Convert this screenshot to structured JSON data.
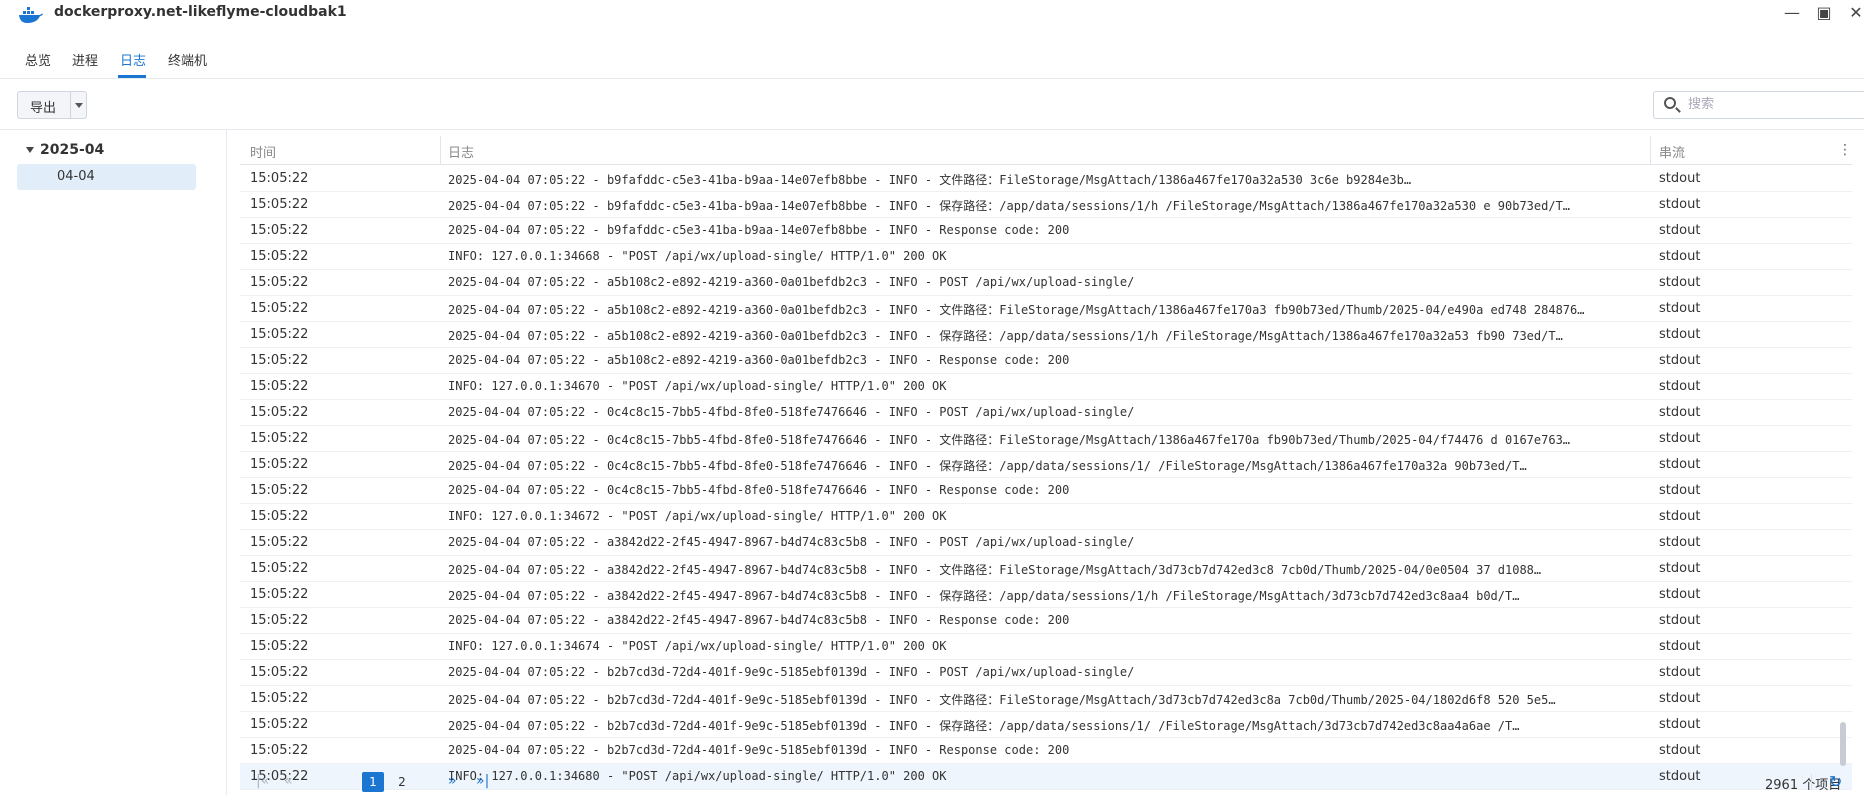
{
  "window": {
    "title": "dockerproxy.net-likeflyme-cloudbak1",
    "minimize_glyph": "—",
    "maximize_glyph": "▣",
    "close_glyph": "✕"
  },
  "tabs": [
    {
      "label": "总览"
    },
    {
      "label": "进程"
    },
    {
      "label": "日志"
    },
    {
      "label": "终端机"
    }
  ],
  "active_tab": "日志",
  "toolbar": {
    "export_label": "导出",
    "search_placeholder": "搜索",
    "search_value": ""
  },
  "sidebar": {
    "year": "2025-04",
    "month": "04-04"
  },
  "columns": {
    "time": "时间",
    "log": "日志",
    "stream": "串流"
  },
  "rows": [
    {
      "time": "15:05:22",
      "message": "2025-04-04 07:05:22 - b9fafddc-c5e3-41ba-b9aa-14e07efb8bbe - INFO - 文件路径：FileStorage/MsgAttach/1386a467fe170a32a530          3c6e  b9284e3b…",
      "stream": "stdout"
    },
    {
      "time": "15:05:22",
      "message": "2025-04-04 07:05:22 - b9fafddc-c5e3-41ba-b9aa-14e07efb8bbe - INFO - 保存路径：/app/data/sessions/1/h          /FileStorage/MsgAttach/1386a467fe170a32a530  e   90b73ed/T…",
      "stream": "stdout"
    },
    {
      "time": "15:05:22",
      "message": "2025-04-04 07:05:22 - b9fafddc-c5e3-41ba-b9aa-14e07efb8bbe - INFO - Response code: 200",
      "stream": "stdout"
    },
    {
      "time": "15:05:22",
      "message": "INFO:     127.0.0.1:34668 - \"POST /api/wx/upload-single/ HTTP/1.0\" 200 OK",
      "stream": "stdout"
    },
    {
      "time": "15:05:22",
      "message": "2025-04-04 07:05:22 - a5b108c2-e892-4219-a360-0a01befdb2c3 - INFO - POST /api/wx/upload-single/",
      "stream": "stdout"
    },
    {
      "time": "15:05:22",
      "message": "2025-04-04 07:05:22 - a5b108c2-e892-4219-a360-0a01befdb2c3 - INFO - 文件路径：FileStorage/MsgAttach/1386a467fe170a3      fb90b73ed/Thumb/2025-04/e490a    ed748 284876…",
      "stream": "stdout"
    },
    {
      "time": "15:05:22",
      "message": "2025-04-04 07:05:22 - a5b108c2-e892-4219-a360-0a01befdb2c3 - INFO - 保存路径：/app/data/sessions/1/h         /FileStorage/MsgAttach/1386a467fe170a32a53  fb90 73ed/T…",
      "stream": "stdout"
    },
    {
      "time": "15:05:22",
      "message": "2025-04-04 07:05:22 - a5b108c2-e892-4219-a360-0a01befdb2c3 - INFO - Response code: 200",
      "stream": "stdout"
    },
    {
      "time": "15:05:22",
      "message": "INFO:     127.0.0.1:34670 - \"POST /api/wx/upload-single/ HTTP/1.0\" 200 OK",
      "stream": "stdout"
    },
    {
      "time": "15:05:22",
      "message": "2025-04-04 07:05:22 - 0c4c8c15-7bb5-4fbd-8fe0-518fe7476646 - INFO - POST /api/wx/upload-single/",
      "stream": "stdout"
    },
    {
      "time": "15:05:22",
      "message": "2025-04-04 07:05:22 - 0c4c8c15-7bb5-4fbd-8fe0-518fe7476646 - INFO - 文件路径：FileStorage/MsgAttach/1386a467fe170a    fb90b73ed/Thumb/2025-04/f74476  d  0167e763…",
      "stream": "stdout"
    },
    {
      "time": "15:05:22",
      "message": "2025-04-04 07:05:22 - 0c4c8c15-7bb5-4fbd-8fe0-518fe7476646 - INFO - 保存路径：/app/data/sessions/1/        /FileStorage/MsgAttach/1386a467fe170a32a   90b73ed/T…",
      "stream": "stdout"
    },
    {
      "time": "15:05:22",
      "message": "2025-04-04 07:05:22 - 0c4c8c15-7bb5-4fbd-8fe0-518fe7476646 - INFO - Response code: 200",
      "stream": "stdout"
    },
    {
      "time": "15:05:22",
      "message": "INFO:     127.0.0.1:34672 - \"POST /api/wx/upload-single/ HTTP/1.0\" 200 OK",
      "stream": "stdout"
    },
    {
      "time": "15:05:22",
      "message": "2025-04-04 07:05:22 - a3842d22-2f45-4947-8967-b4d74c83c5b8 - INFO - POST /api/wx/upload-single/",
      "stream": "stdout"
    },
    {
      "time": "15:05:22",
      "message": "2025-04-04 07:05:22 - a3842d22-2f45-4947-8967-b4d74c83c5b8 - INFO - 文件路径：FileStorage/MsgAttach/3d73cb7d742ed3c8    7cb0d/Thumb/2025-04/0e0504  37  d1088…",
      "stream": "stdout"
    },
    {
      "time": "15:05:22",
      "message": "2025-04-04 07:05:22 - a3842d22-2f45-4947-8967-b4d74c83c5b8 - INFO - 保存路径：/app/data/sessions/1/h         /FileStorage/MsgAttach/3d73cb7d742ed3c8aa4    b0d/T…",
      "stream": "stdout"
    },
    {
      "time": "15:05:22",
      "message": "2025-04-04 07:05:22 - a3842d22-2f45-4947-8967-b4d74c83c5b8 - INFO - Response code: 200",
      "stream": "stdout"
    },
    {
      "time": "15:05:22",
      "message": "INFO:     127.0.0.1:34674 - \"POST /api/wx/upload-single/ HTTP/1.0\" 200 OK",
      "stream": "stdout"
    },
    {
      "time": "15:05:22",
      "message": "2025-04-04 07:05:22 - b2b7cd3d-72d4-401f-9e9c-5185ebf0139d - INFO - POST /api/wx/upload-single/",
      "stream": "stdout"
    },
    {
      "time": "15:05:22",
      "message": "2025-04-04 07:05:22 - b2b7cd3d-72d4-401f-9e9c-5185ebf0139d - INFO - 文件路径：FileStorage/MsgAttach/3d73cb7d742ed3c8a    7cb0d/Thumb/2025-04/1802d6f8  520  5e5…",
      "stream": "stdout"
    },
    {
      "time": "15:05:22",
      "message": "2025-04-04 07:05:22 - b2b7cd3d-72d4-401f-9e9c-5185ebf0139d - INFO - 保存路径：/app/data/sessions/1/          /FileStorage/MsgAttach/3d73cb7d742ed3c8aa4a6ae      /T…",
      "stream": "stdout"
    },
    {
      "time": "15:05:22",
      "message": "2025-04-04 07:05:22 - b2b7cd3d-72d4-401f-9e9c-5185ebf0139d - INFO - Response code: 200",
      "stream": "stdout"
    },
    {
      "time": "15:05:22",
      "message": "INFO:     127.0.0.1:34680 - \"POST /api/wx/upload-single/ HTTP/1.0\" 200 OK",
      "stream": "stdout"
    }
  ],
  "pagination": {
    "first_glyph": "|«",
    "prev_glyph": "«",
    "pages": [
      "1",
      "2"
    ],
    "current_page": "1",
    "next_glyph": "»",
    "last_glyph": "»|",
    "total": "2961 个项目"
  },
  "colors": {
    "accent": "#1b76d2",
    "selected_row": "#eef5fc",
    "tree_selected": "#e1edf9"
  }
}
